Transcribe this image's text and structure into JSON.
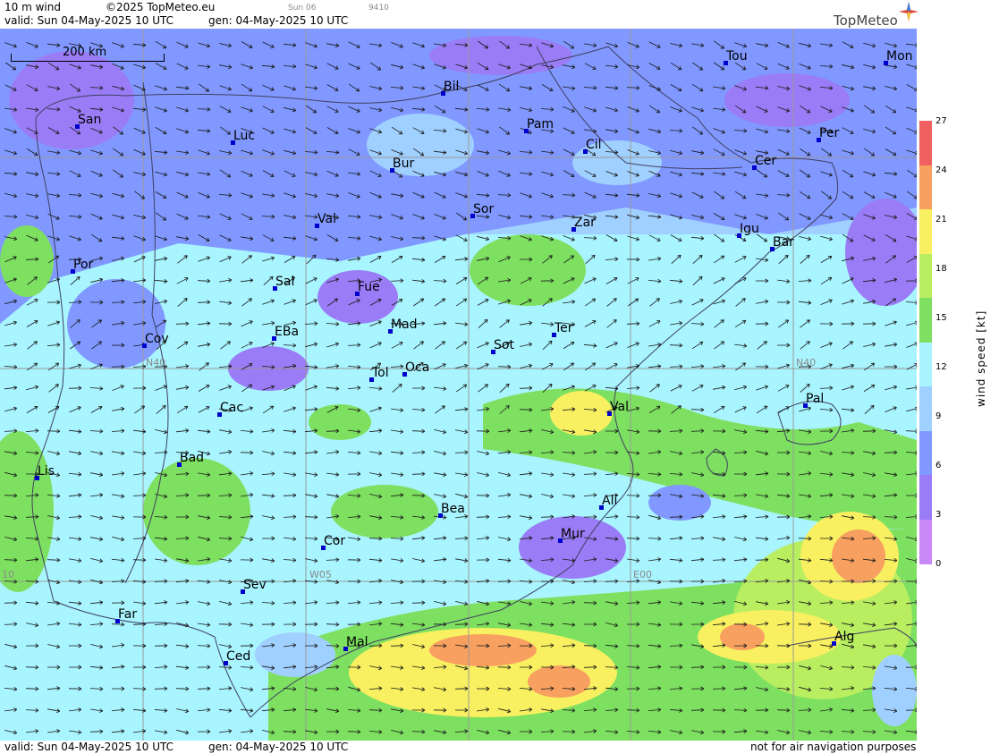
{
  "header": {
    "product": "10 m wind",
    "copyright": "©2025 TopMeteo.eu",
    "valid": "valid:  Sun  04-May-2025  10 UTC",
    "gen": "gen: 04-May-2025 10 UTC",
    "small_day": "Sun 06",
    "small_code": "9410"
  },
  "footer": {
    "valid": "valid:  Sun  04-May-2025  10 UTC",
    "gen": "gen: 04-May-2025 10 UTC",
    "note": "not for air navigation purposes"
  },
  "logo": {
    "text": "TopMeteo"
  },
  "scale": {
    "label": "200 km"
  },
  "legend": {
    "unit_label": "wind speed [kt]",
    "ticks": [
      "27",
      "24",
      "21",
      "18",
      "15",
      "12",
      "9",
      "6",
      "3",
      "0"
    ],
    "colors": [
      "#f06060",
      "#f8a060",
      "#f8f060",
      "#b8ee60",
      "#7ee060",
      "#a8f4ff",
      "#a0d0ff",
      "#8098ff",
      "#9a7cf6",
      "#c888f6"
    ]
  },
  "grid_labels": {
    "n40_left": "N40",
    "n40_right": "N40",
    "w05": "W05",
    "e00": "E00",
    "w10": "10"
  },
  "cities": [
    {
      "name": "Tou"
    },
    {
      "name": "Mon"
    },
    {
      "name": "Bil"
    },
    {
      "name": "San"
    },
    {
      "name": "Pam"
    },
    {
      "name": "Luc"
    },
    {
      "name": "Cil"
    },
    {
      "name": "Per"
    },
    {
      "name": "Bur"
    },
    {
      "name": "Cer"
    },
    {
      "name": "Sor"
    },
    {
      "name": "Val"
    },
    {
      "name": "Zar"
    },
    {
      "name": "Igu"
    },
    {
      "name": "Bar"
    },
    {
      "name": "Por"
    },
    {
      "name": "Sal"
    },
    {
      "name": "Fue"
    },
    {
      "name": "Mad"
    },
    {
      "name": "Cov"
    },
    {
      "name": "EBa"
    },
    {
      "name": "Ter"
    },
    {
      "name": "Sot"
    },
    {
      "name": "Tol"
    },
    {
      "name": "Oca"
    },
    {
      "name": "Pal"
    },
    {
      "name": "Cac"
    },
    {
      "name": "Val"
    },
    {
      "name": "Bad"
    },
    {
      "name": "Lis"
    },
    {
      "name": "Ali"
    },
    {
      "name": "Bea"
    },
    {
      "name": "Mur"
    },
    {
      "name": "Cor"
    },
    {
      "name": "Sev"
    },
    {
      "name": "Far"
    },
    {
      "name": "Alg"
    },
    {
      "name": "Mal"
    },
    {
      "name": "Ced"
    }
  ]
}
